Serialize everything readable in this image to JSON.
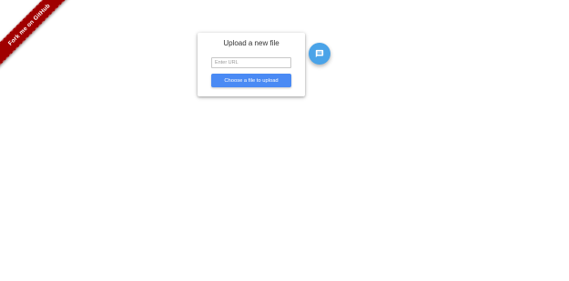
{
  "ribbon": {
    "label": "Fork me on GitHub",
    "color": "#a00000"
  },
  "upload_card": {
    "title": "Upload a new file",
    "url_input": {
      "value": "",
      "placeholder": "Enter URL"
    },
    "upload_button_label": "Choose a file to upload",
    "button_color": "#4a8af4"
  },
  "fab": {
    "icon": "chat-icon",
    "color": "#4aa3e8"
  }
}
